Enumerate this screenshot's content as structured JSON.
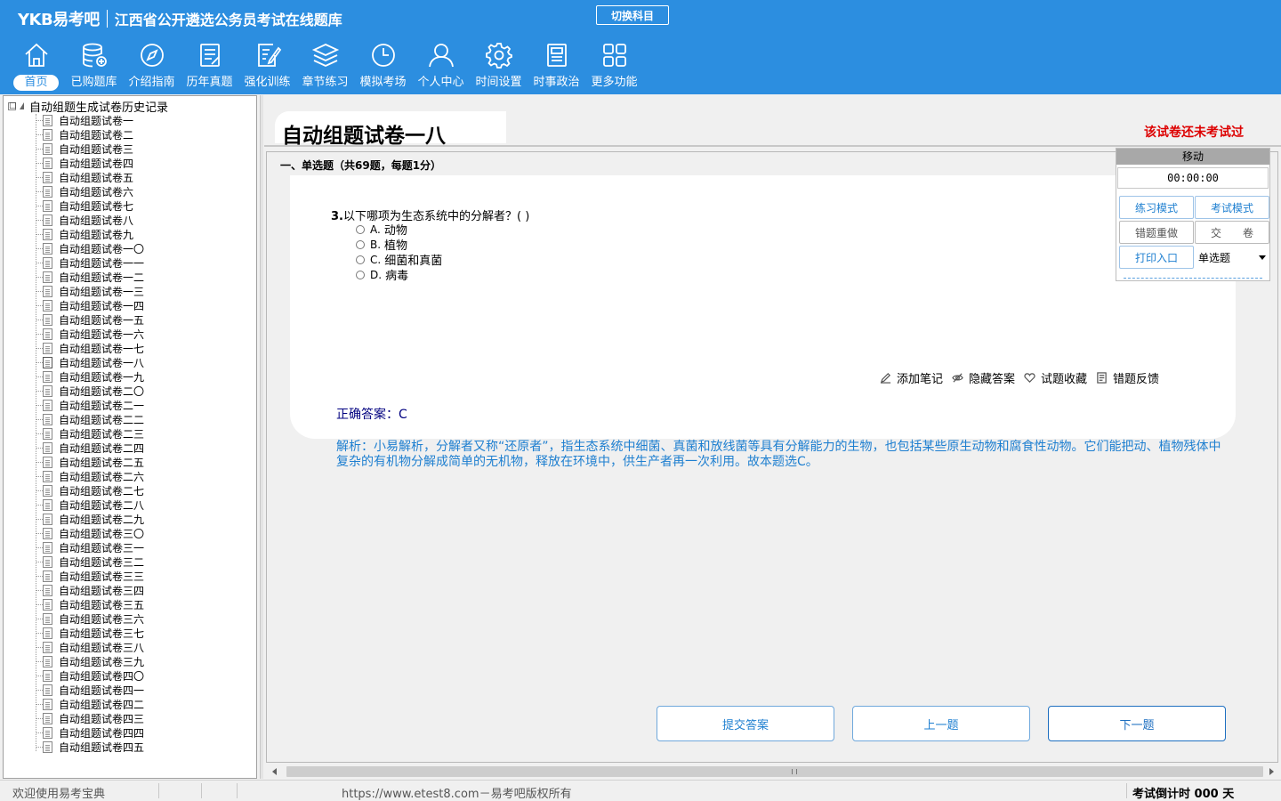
{
  "header": {
    "logo": "YKB易考吧",
    "app_title": "江西省公开遴选公务员考试在线题库",
    "switch_subject": "切换科目"
  },
  "nav": [
    {
      "label": "首页",
      "icon": "home-icon",
      "active": true
    },
    {
      "label": "已购题库",
      "icon": "database-icon"
    },
    {
      "label": "介绍指南",
      "icon": "compass-icon"
    },
    {
      "label": "历年真题",
      "icon": "document-list-icon"
    },
    {
      "label": "强化训练",
      "icon": "edit-icon"
    },
    {
      "label": "章节练习",
      "icon": "layers-icon"
    },
    {
      "label": "模拟考场",
      "icon": "clock-icon"
    },
    {
      "label": "个人中心",
      "icon": "user-icon"
    },
    {
      "label": "时间设置",
      "icon": "gear-icon"
    },
    {
      "label": "时事政治",
      "icon": "newspaper-icon"
    },
    {
      "label": "更多功能",
      "icon": "grid-icon"
    }
  ],
  "tree": {
    "expander": "□",
    "root": "自动组题生成试卷历史记录",
    "items": [
      "自动组题试卷一",
      "自动组题试卷二",
      "自动组题试卷三",
      "自动组题试卷四",
      "自动组题试卷五",
      "自动组题试卷六",
      "自动组题试卷七",
      "自动组题试卷八",
      "自动组题试卷九",
      "自动组题试卷一〇",
      "自动组题试卷一一",
      "自动组题试卷一二",
      "自动组题试卷一三",
      "自动组题试卷一四",
      "自动组题试卷一五",
      "自动组题试卷一六",
      "自动组题试卷一七",
      "自动组题试卷一八",
      "自动组题试卷一九",
      "自动组题试卷二〇",
      "自动组题试卷二一",
      "自动组题试卷二二",
      "自动组题试卷二三",
      "自动组题试卷二四",
      "自动组题试卷二五",
      "自动组题试卷二六",
      "自动组题试卷二七",
      "自动组题试卷二八",
      "自动组题试卷二九",
      "自动组题试卷三〇",
      "自动组题试卷三一",
      "自动组题试卷三二",
      "自动组题试卷三三",
      "自动组题试卷三四",
      "自动组题试卷三五",
      "自动组题试卷三六",
      "自动组题试卷三七",
      "自动组题试卷三八",
      "自动组题试卷三九",
      "自动组题试卷四〇",
      "自动组题试卷四一",
      "自动组题试卷四二",
      "自动组题试卷四三",
      "自动组题试卷四四",
      "自动组题试卷四五"
    ],
    "current_index": 17
  },
  "main": {
    "paper_title": "自动组题试卷一八",
    "status": "该试卷还未考试过",
    "section_header": "一、单选题（共69题，每题1分）",
    "question": {
      "number": "3.",
      "text": "以下哪项为生态系统中的分解者？( )",
      "options": [
        {
          "key": "A.",
          "text": "动物"
        },
        {
          "key": "B.",
          "text": "植物"
        },
        {
          "key": "C.",
          "text": "细菌和真菌"
        },
        {
          "key": "D.",
          "text": "病毒"
        }
      ]
    },
    "actions": {
      "add_note": "添加笔记",
      "hide_answer": "隐藏答案",
      "favorite": "试题收藏",
      "feedback": "错题反馈"
    },
    "answer": "正确答案：C",
    "analysis": "解析：小易解析，分解者又称“还原者”，指生态系统中细菌、真菌和放线菌等具有分解能力的生物，也包括某些原生动物和腐食性动物。它们能把动、植物残体中复杂的有机物分解成简单的无机物，释放在环境中，供生产者再一次利用。故本题选C。"
  },
  "control": {
    "move": "移动",
    "timer": "00:00:00",
    "practice_mode": "练习模式",
    "exam_mode": "考试模式",
    "redo_wrong": "错题重做",
    "submit_paper": "交　　卷",
    "print": "打印入口",
    "question_type": "单选题"
  },
  "buttons": {
    "submit_answer": "提交答案",
    "prev": "上一题",
    "next": "下一题"
  },
  "statusbar": {
    "welcome": "欢迎使用易考宝典",
    "copyright": "https://www.etest8.com－易考吧版权所有",
    "countdown": "考试倒计时 000 天"
  },
  "colors": {
    "header_bg": "#2c8ee0",
    "status_red": "#dd0000",
    "answer_blue": "#000080",
    "analysis_blue": "#1e7fd0"
  }
}
